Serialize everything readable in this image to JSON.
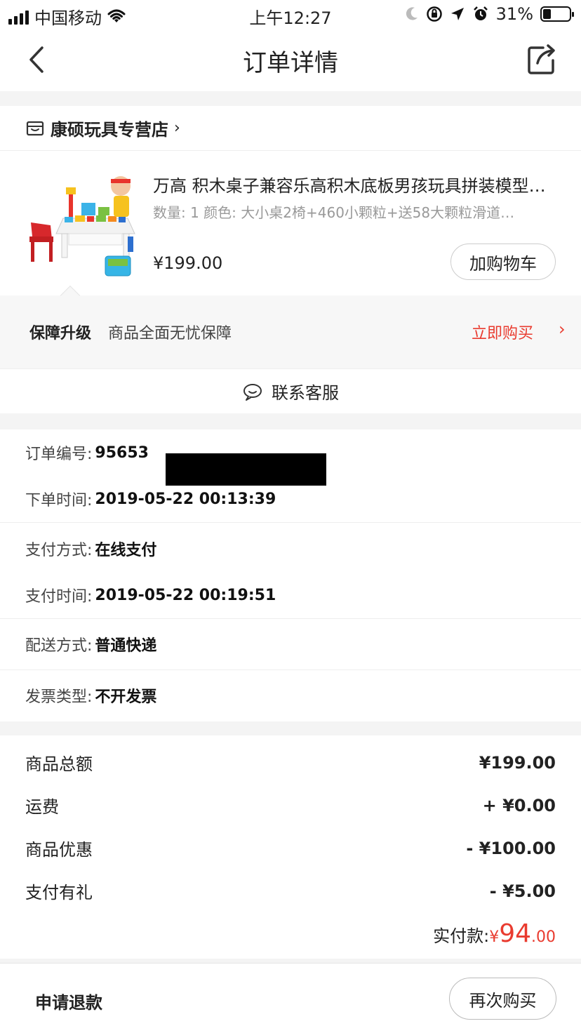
{
  "status_bar": {
    "carrier": "中国移动",
    "time": "上午12:27",
    "battery": "31%",
    "battery_level": 0.31
  },
  "nav": {
    "title": "订单详情",
    "back_icon": "chevron-left-icon",
    "share_icon": "share-icon"
  },
  "store": {
    "name": "康硕玩具专营店",
    "chevron": "›"
  },
  "product": {
    "title": "万高 积木桌子兼容乐高积木底板男孩玩具拼装模型…",
    "spec": "数量: 1  颜色: 大小桌2椅+460小颗粒+送58大颗粒滑道…",
    "price": "¥199.00",
    "add_cart": "加购物车"
  },
  "guarantee": {
    "label": "保障升级",
    "desc": "商品全面无忧保障",
    "buy": "立即购买",
    "chevron": "›"
  },
  "service": {
    "label": "联系客服"
  },
  "order_info": {
    "order_no_label": "订单编号:",
    "order_no": "95653",
    "order_time_label": "下单时间:",
    "order_time": "2019-05-22 00:13:39",
    "pay_method_label": "支付方式:",
    "pay_method": "在线支付",
    "pay_time_label": "支付时间:",
    "pay_time": "2019-05-22 00:19:51",
    "delivery_label": "配送方式:",
    "delivery": "普通快递",
    "invoice_label": "发票类型:",
    "invoice": "不开发票"
  },
  "totals": {
    "rows": [
      {
        "label": "商品总额",
        "value": "¥199.00"
      },
      {
        "label": "运费",
        "value": "+ ¥0.00"
      },
      {
        "label": "商品优惠",
        "value": "- ¥100.00"
      },
      {
        "label": "支付有礼",
        "value": "- ¥5.00"
      }
    ],
    "paid_label": "实付款:",
    "paid_currency": "¥",
    "paid_int": "94",
    "paid_dec": ".00"
  },
  "bottom": {
    "refund": "申请退款",
    "rebuy": "再次购买"
  },
  "colors": {
    "accent": "#e93b2f"
  }
}
